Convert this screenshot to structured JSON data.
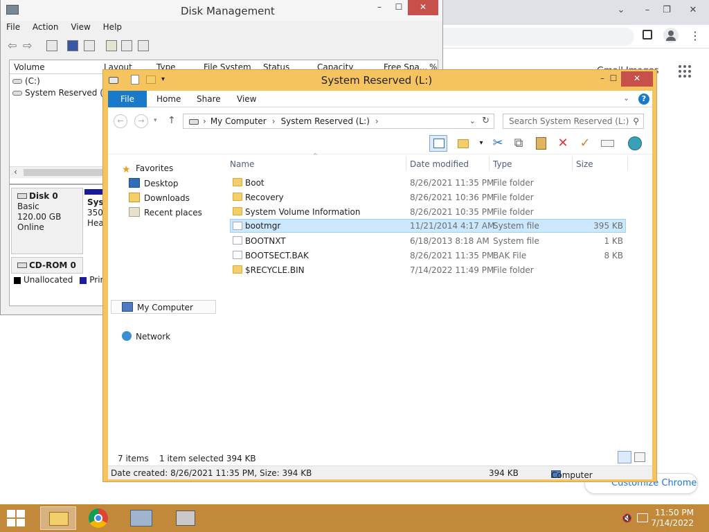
{
  "chrome": {
    "gmail_fragment": "Gmail  Images",
    "customize_label": "Customize Chrome",
    "min": "⌄",
    "restore": "–",
    "max": "❐",
    "close": "✕",
    "menu_dots": "⋮"
  },
  "dm": {
    "title": "Disk Management",
    "menu": [
      "File",
      "Action",
      "View",
      "Help"
    ],
    "columns": [
      "Volume",
      "Layout",
      "Type",
      "File System",
      "Status",
      "Capacity",
      "Free Spa...",
      "%"
    ],
    "volumes": [
      "(C:)",
      "System Reserved (..."
    ],
    "disk0": {
      "name": "Disk 0",
      "type": "Basic",
      "size": "120.00 GB",
      "state": "Online"
    },
    "part": {
      "name": "Syst",
      "size": "350",
      "health": "Hea"
    },
    "cdrom": "CD-ROM 0",
    "legend": [
      "Unallocated",
      "Prima"
    ],
    "colors": {
      "unallocated": "#000000",
      "primary": "#1a1a9c"
    }
  },
  "ex": {
    "title": "System Reserved (L:)",
    "tabs": [
      "File",
      "Home",
      "Share",
      "View"
    ],
    "breadcrumb": [
      "My Computer",
      "System Reserved (L:)"
    ],
    "search_placeholder": "Search System Reserved (L:)",
    "nav": {
      "favorites": "Favorites",
      "desktop": "Desktop",
      "downloads": "Downloads",
      "recent": "Recent places",
      "computer": "My Computer",
      "network": "Network"
    },
    "columns": [
      "Name",
      "Date modified",
      "Type",
      "Size"
    ],
    "files": [
      {
        "name": "Boot",
        "date": "8/26/2021 11:35 PM",
        "type": "File folder",
        "size": "",
        "icon": "folder"
      },
      {
        "name": "Recovery",
        "date": "8/26/2021 10:36 PM",
        "type": "File folder",
        "size": "",
        "icon": "folder"
      },
      {
        "name": "System Volume Information",
        "date": "8/26/2021 10:35 PM",
        "type": "File folder",
        "size": "",
        "icon": "folder"
      },
      {
        "name": "bootmgr",
        "date": "11/21/2014 4:17 AM",
        "type": "System file",
        "size": "395 KB",
        "icon": "system-file"
      },
      {
        "name": "BOOTNXT",
        "date": "6/18/2013 8:18 AM",
        "type": "System file",
        "size": "1 KB",
        "icon": "file"
      },
      {
        "name": "BOOTSECT.BAK",
        "date": "8/26/2021 11:35 PM",
        "type": "BAK File",
        "size": "8 KB",
        "icon": "file"
      },
      {
        "name": "$RECYCLE.BIN",
        "date": "7/14/2022 11:49 PM",
        "type": "File folder",
        "size": "",
        "icon": "folder"
      }
    ],
    "status": {
      "count": "7 items",
      "selected": "1 item selected  394 KB"
    },
    "details": {
      "info": "Date created: 8/26/2021 11:35 PM, Size: 394 KB",
      "size": "394 KB",
      "location": "Computer"
    }
  },
  "taskbar": {
    "time": "11:50 PM",
    "date": "7/14/2022"
  },
  "accent": {
    "explorer_frame": "#f6c45f",
    "selection": "#cce8ff",
    "file_tab": "#1979ca",
    "taskbar": "#c2893a"
  }
}
